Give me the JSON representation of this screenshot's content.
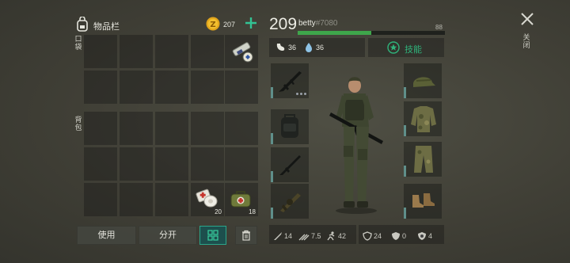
{
  "inventory": {
    "title": "物品栏",
    "coins": "207",
    "section_pockets": "口袋",
    "section_backpack": "背包",
    "item_counts": {
      "bandage": "20",
      "bag": "18"
    }
  },
  "actions": {
    "use": "使用",
    "split": "分开"
  },
  "player": {
    "level": "209",
    "name": "betty",
    "tag": "#7080",
    "health": "88",
    "health_fraction": 0.5,
    "food": "36",
    "water": "36",
    "skills_label": "技能"
  },
  "close_label": "关闭",
  "stats": {
    "melee": "14",
    "ranged": "7.5",
    "speed": "42",
    "armor": "24",
    "defense": "0",
    "protection": "4"
  },
  "colors": {
    "health_bar": "#3ea64b",
    "accent": "#2fb37b",
    "slot_bar": "#5f8f8a"
  }
}
